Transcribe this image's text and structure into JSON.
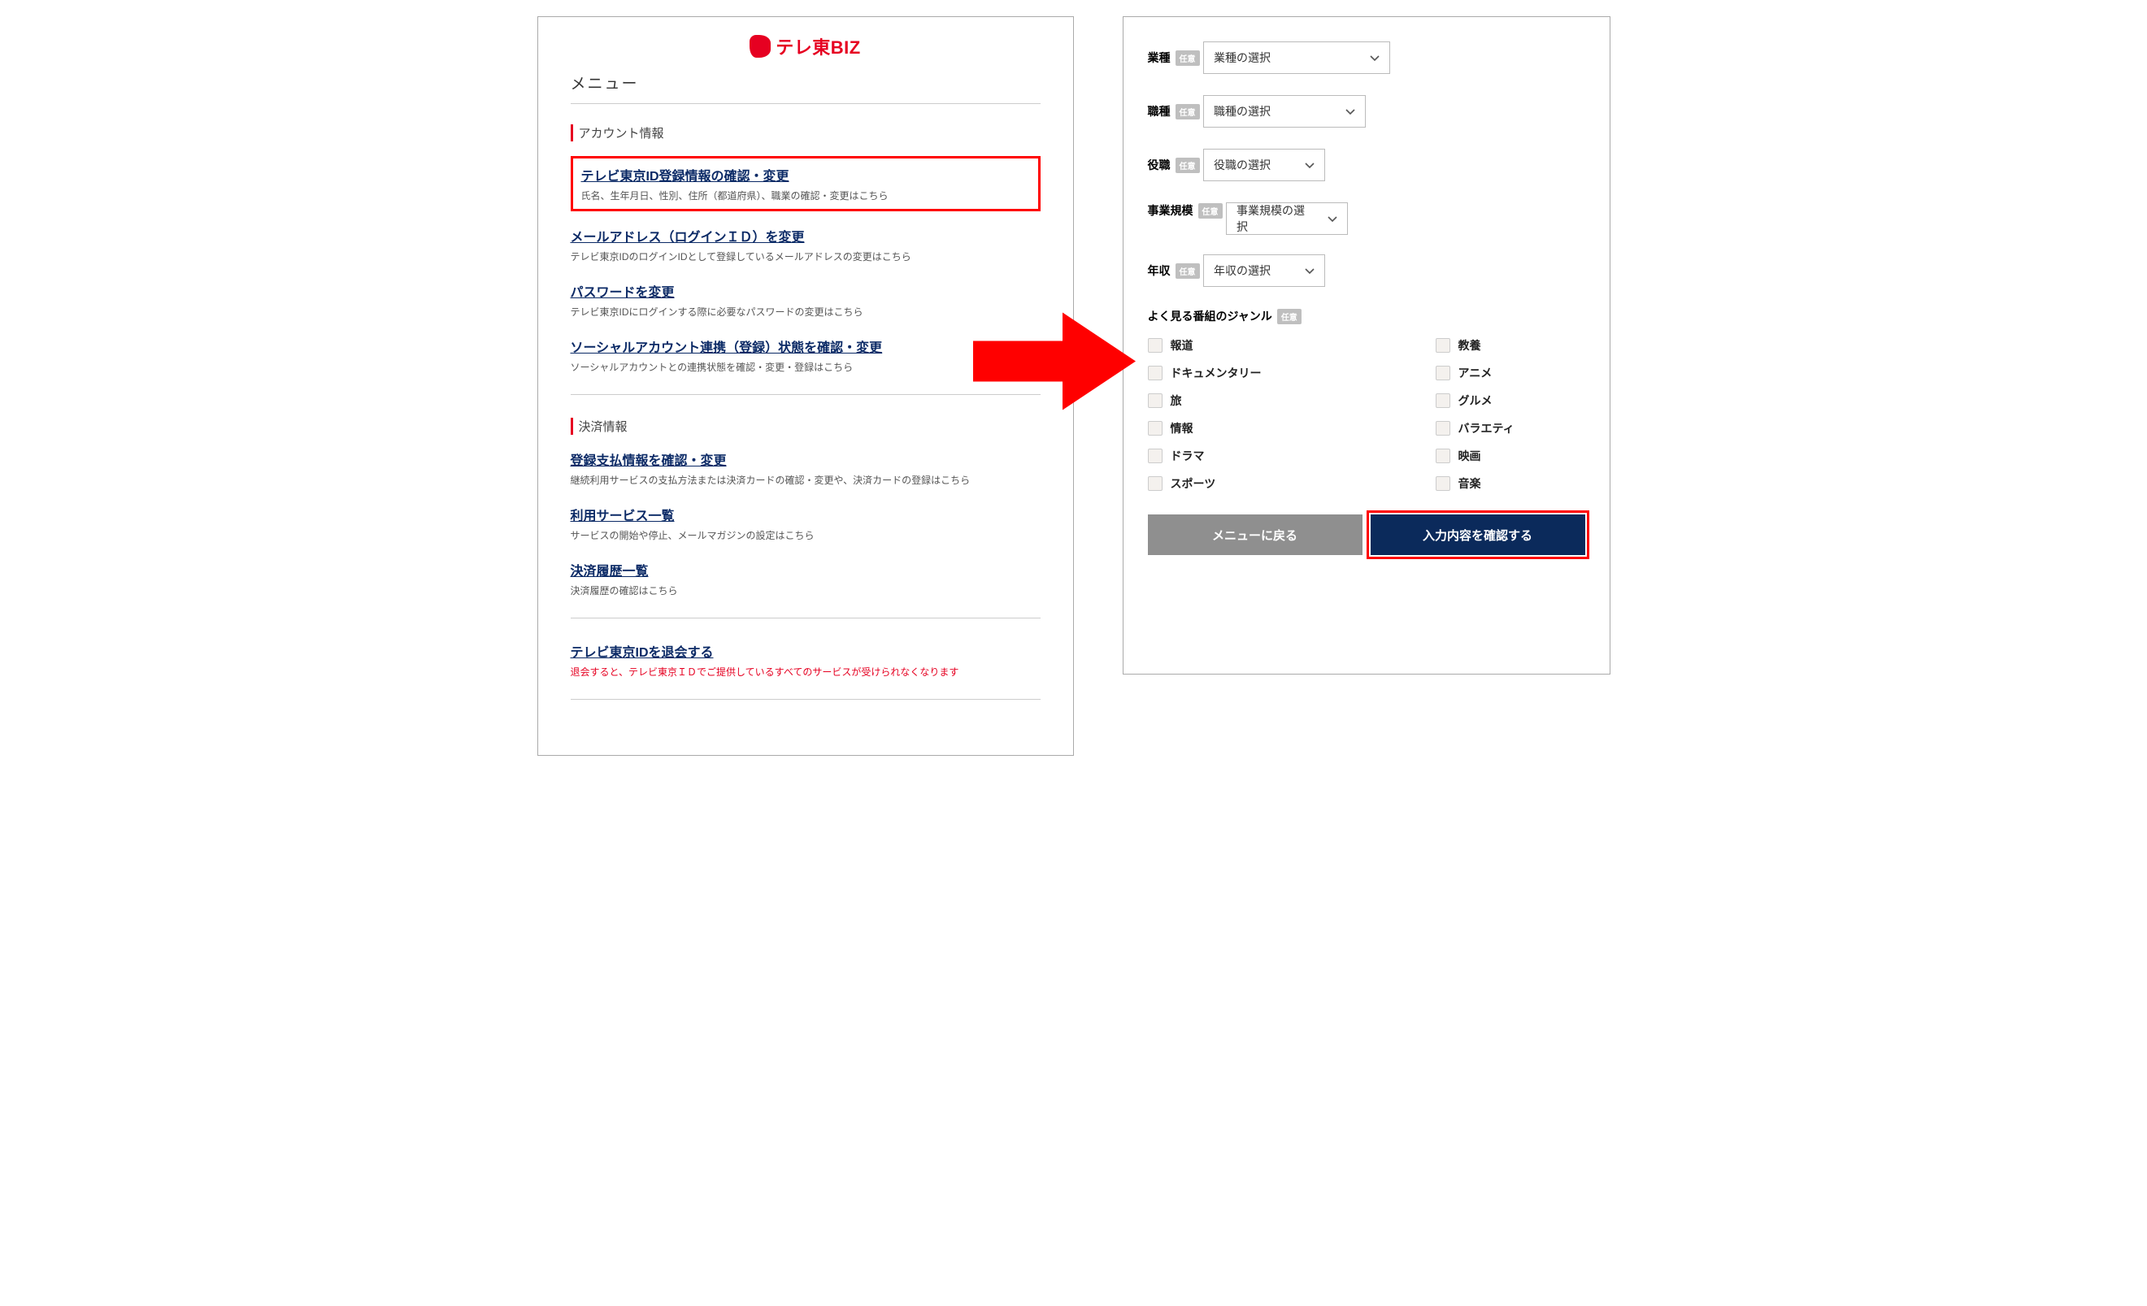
{
  "logo": {
    "text": "テレ東BIZ"
  },
  "left": {
    "menu": "メニュー",
    "sec_account": "アカウント情報",
    "sec_payment": "決済情報",
    "items": {
      "id_info": {
        "title": "テレビ東京ID登録情報の確認・変更",
        "desc": "氏名、生年月日、性別、住所（都道府県）、職業の確認・変更はこちら"
      },
      "mail": {
        "title": "メールアドレス（ログインＩＤ）を変更",
        "desc": "テレビ東京IDのログインIDとして登録しているメールアドレスの変更はこちら"
      },
      "pw": {
        "title": "パスワードを変更",
        "desc": "テレビ東京IDにログインする際に必要なパスワードの変更はこちら"
      },
      "social": {
        "title": "ソーシャルアカウント連携（登録）状態を確認・変更",
        "desc": "ソーシャルアカウントとの連携状態を確認・変更・登録はこちら"
      },
      "pay_info": {
        "title": "登録支払情報を確認・変更",
        "desc": "継続利用サービスの支払方法または決済カードの確認・変更や、決済カードの登録はこちら"
      },
      "services": {
        "title": "利用サービス一覧",
        "desc": "サービスの開始や停止、メールマガジンの設定はこちら"
      },
      "history": {
        "title": "決済履歴一覧",
        "desc": "決済履歴の確認はこちら"
      },
      "withdraw": {
        "title": "テレビ東京IDを退会する",
        "desc": "退会すると、テレビ東京ＩＤでご提供しているすべてのサービスが受けられなくなります"
      }
    }
  },
  "right": {
    "optional": "任意",
    "industry": {
      "label": "業種",
      "placeholder": "業種の選択"
    },
    "occupation": {
      "label": "職種",
      "placeholder": "職種の選択"
    },
    "position": {
      "label": "役職",
      "placeholder": "役職の選択"
    },
    "size": {
      "label": "事業規模",
      "placeholder": "事業規模の選択"
    },
    "income": {
      "label": "年収",
      "placeholder": "年収の選択"
    },
    "genre_label": "よく見る番組のジャンル",
    "genres": [
      "報道",
      "教養",
      "ドキュメンタリー",
      "アニメ",
      "旅",
      "グルメ",
      "情報",
      "バラエティ",
      "ドラマ",
      "映画",
      "スポーツ",
      "音楽"
    ],
    "btn_back": "メニューに戻る",
    "btn_confirm": "入力内容を確認する"
  }
}
